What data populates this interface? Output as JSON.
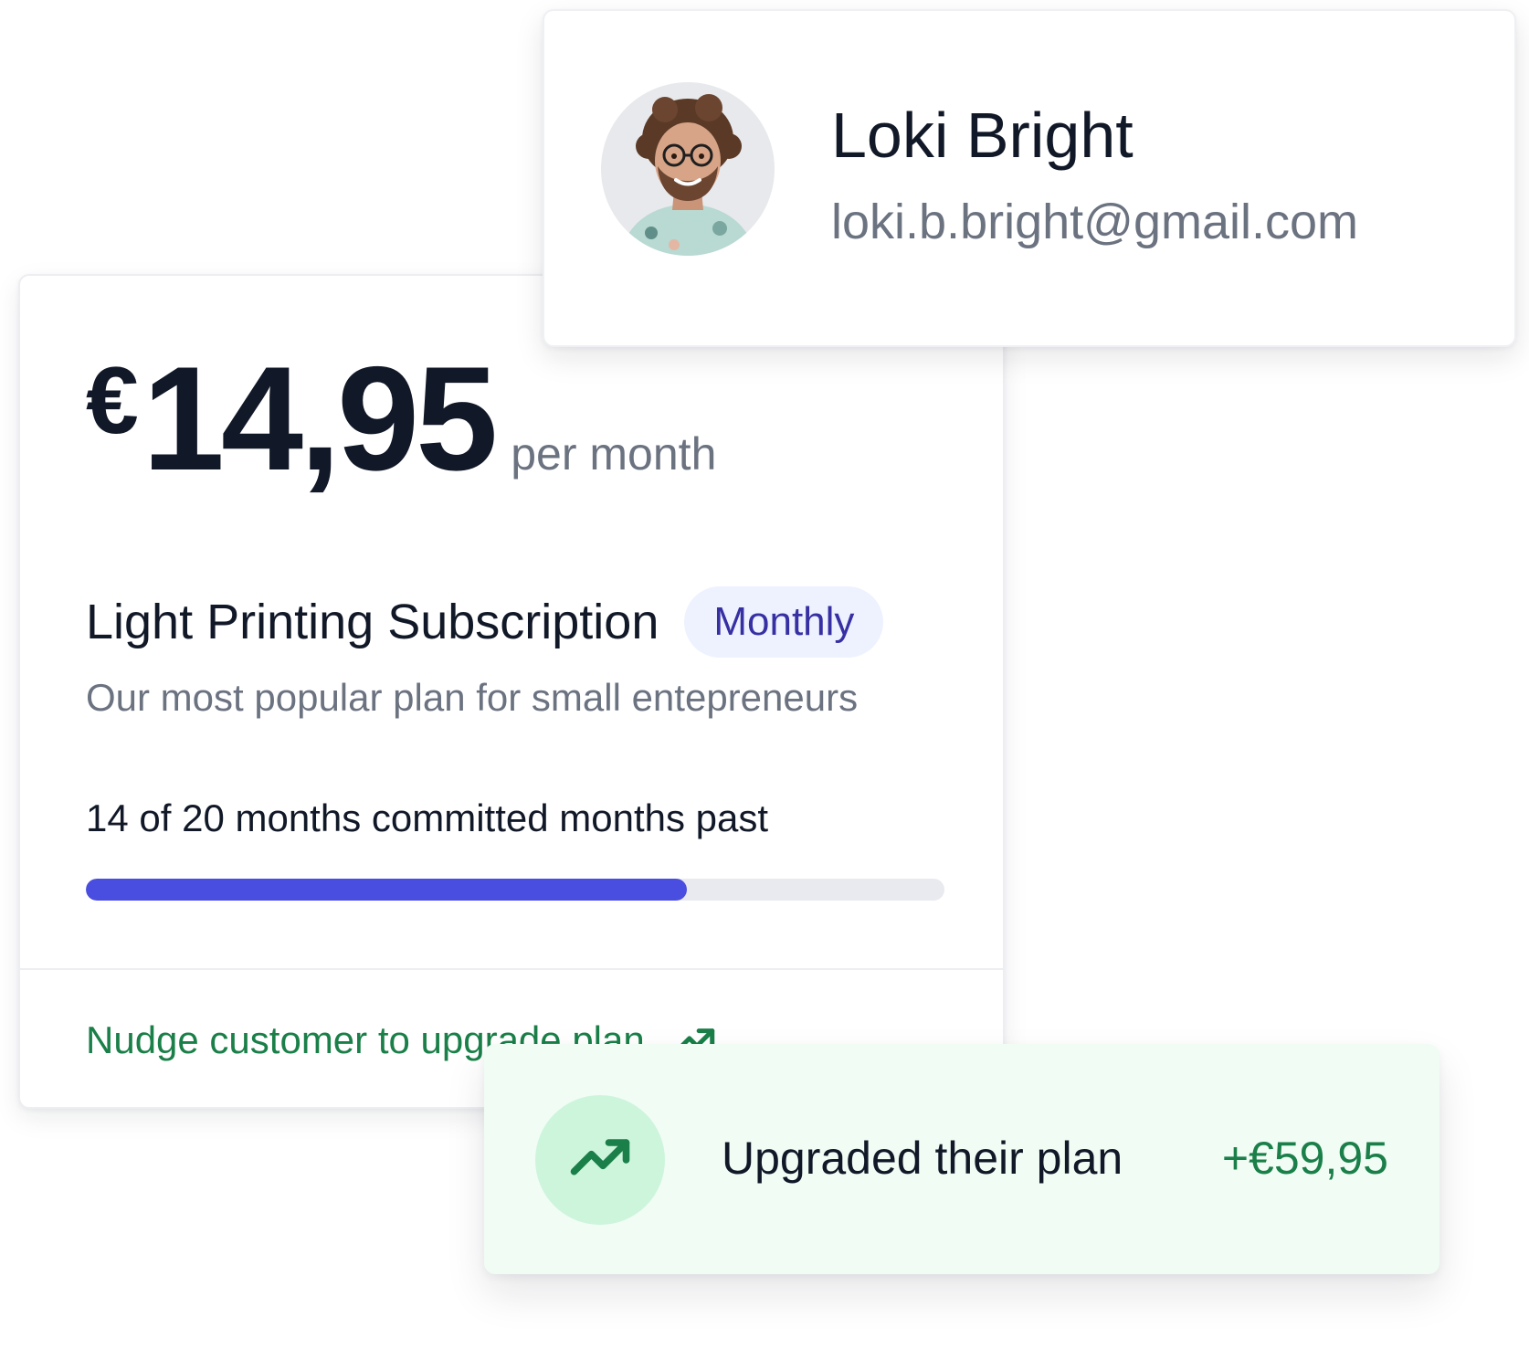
{
  "subscription": {
    "currency": "€",
    "amount": "14,95",
    "period": "per month",
    "plan_name": "Light Printing Subscription",
    "billing_badge": "Monthly",
    "description": "Our most popular plan for small entepreneurs",
    "progress_label": "14 of 20 months committed months past",
    "progress_months_past": 14,
    "progress_months_total": 20,
    "nudge_link": "Nudge customer to upgrade plan",
    "nudge_icon": "arrow-up-right-icon"
  },
  "customer": {
    "name": "Loki Bright",
    "email": "loki.b.bright@gmail.com",
    "avatar": "avatar-photo"
  },
  "upgrade": {
    "text": "Upgraded their plan",
    "amount": "+€59,95",
    "icon": "trending-up-icon"
  },
  "colors": {
    "accent": "#4a4ee0",
    "success": "#1a7f48",
    "badge_bg": "#eef2ff",
    "badge_text": "#3730a3",
    "toast_bg": "#f1fcf5",
    "toast_icon_bg": "#cdf5dc"
  }
}
